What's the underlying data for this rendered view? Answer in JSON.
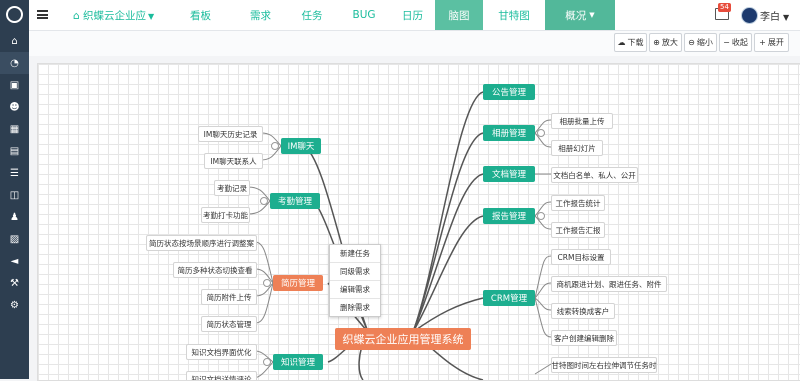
{
  "sidebar": {
    "icons": [
      "home-icon",
      "dashboard-icon",
      "briefcase-icon",
      "users-icon",
      "calendar-icon",
      "book-icon",
      "list-icon",
      "columns-icon",
      "male-icon",
      "image-icon",
      "bullhorn-icon",
      "gavel-icon",
      "cogs-icon"
    ]
  },
  "header": {
    "project": "织蝶云企业应",
    "nav": [
      "看板",
      "需求",
      "任务",
      "BUG",
      "日历",
      "脑图",
      "甘特图",
      "概况"
    ],
    "active_nav": "脑图",
    "mail_badge": "54",
    "username": "李白"
  },
  "toolbar": {
    "buttons": [
      "下载",
      "放大",
      "缩小",
      "收起",
      "展开"
    ]
  },
  "mindmap": {
    "root": "织蝶云企业应用管理系统",
    "left": [
      {
        "label": "IM聊天",
        "leaves": [
          "IM聊天历史记录",
          "IM聊天联系人"
        ]
      },
      {
        "label": "考勤管理",
        "leaves": [
          "考勤记录",
          "考勤打卡功能"
        ]
      },
      {
        "label": "简历管理",
        "leaves": [
          "简历状态按场景顺序进行调整案",
          "简历多种状态切换查看",
          "简历附件上传",
          "简历状态管理"
        ]
      },
      {
        "label": "知识管理",
        "leaves": [
          "知识文档界面优化",
          "知识文档详情评论"
        ]
      }
    ],
    "right": [
      {
        "label": "公告管理",
        "leaves": []
      },
      {
        "label": "相册管理",
        "leaves": [
          "相册批量上传",
          "相册幻灯片"
        ]
      },
      {
        "label": "文档管理",
        "leaves": [
          "文档白名单、私人、公开"
        ]
      },
      {
        "label": "报告管理",
        "leaves": [
          "工作报告统计",
          "工作报告汇报"
        ]
      },
      {
        "label": "CRM管理",
        "leaves": [
          "CRM目标设置",
          "商机跟进计划、跟进任务、附件",
          "线索转换成客户",
          "客户创建编辑删除"
        ]
      },
      {
        "label": "",
        "leaves": [
          "甘特图时间左右拉伸调节任务时"
        ]
      }
    ],
    "context_menu": [
      "新建任务",
      "同级需求",
      "编辑需求",
      "删除需求"
    ]
  }
}
